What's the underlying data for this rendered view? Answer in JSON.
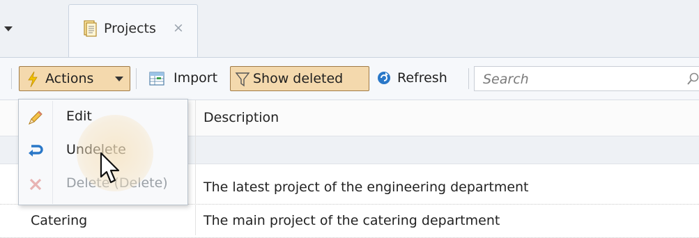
{
  "header": {
    "fragment_text": "page"
  },
  "tabs": [
    {
      "label": "Projects",
      "icon": "document-icon",
      "close": "×"
    }
  ],
  "toolbar": {
    "actions_label": "Actions",
    "import_label": "Import",
    "show_deleted_label": "Show deleted",
    "refresh_label": "Refresh",
    "search_placeholder": "Search"
  },
  "menu": {
    "items": [
      {
        "label": "Edit",
        "icon": "pencil-icon",
        "enabled": true
      },
      {
        "label": "Undelete",
        "icon": "undo-arrow-icon",
        "enabled": true,
        "hovered": true
      },
      {
        "label": "Delete (Delete)",
        "icon": "x-icon",
        "enabled": false
      }
    ]
  },
  "grid": {
    "columns": [
      {
        "label": ""
      },
      {
        "label": "Description"
      }
    ],
    "rows": [
      {
        "name": "",
        "description": "The latest project of the engineering department"
      },
      {
        "name": "Catering",
        "description": "The main project of the catering department"
      }
    ]
  },
  "colors": {
    "pressed_button_bg": "#f4d9ad",
    "pressed_button_border": "#a07a45",
    "toolbar_bg": "#f6f8fb",
    "lightning_yellow": "#f2c200",
    "refresh_blue": "#2a78c8"
  }
}
